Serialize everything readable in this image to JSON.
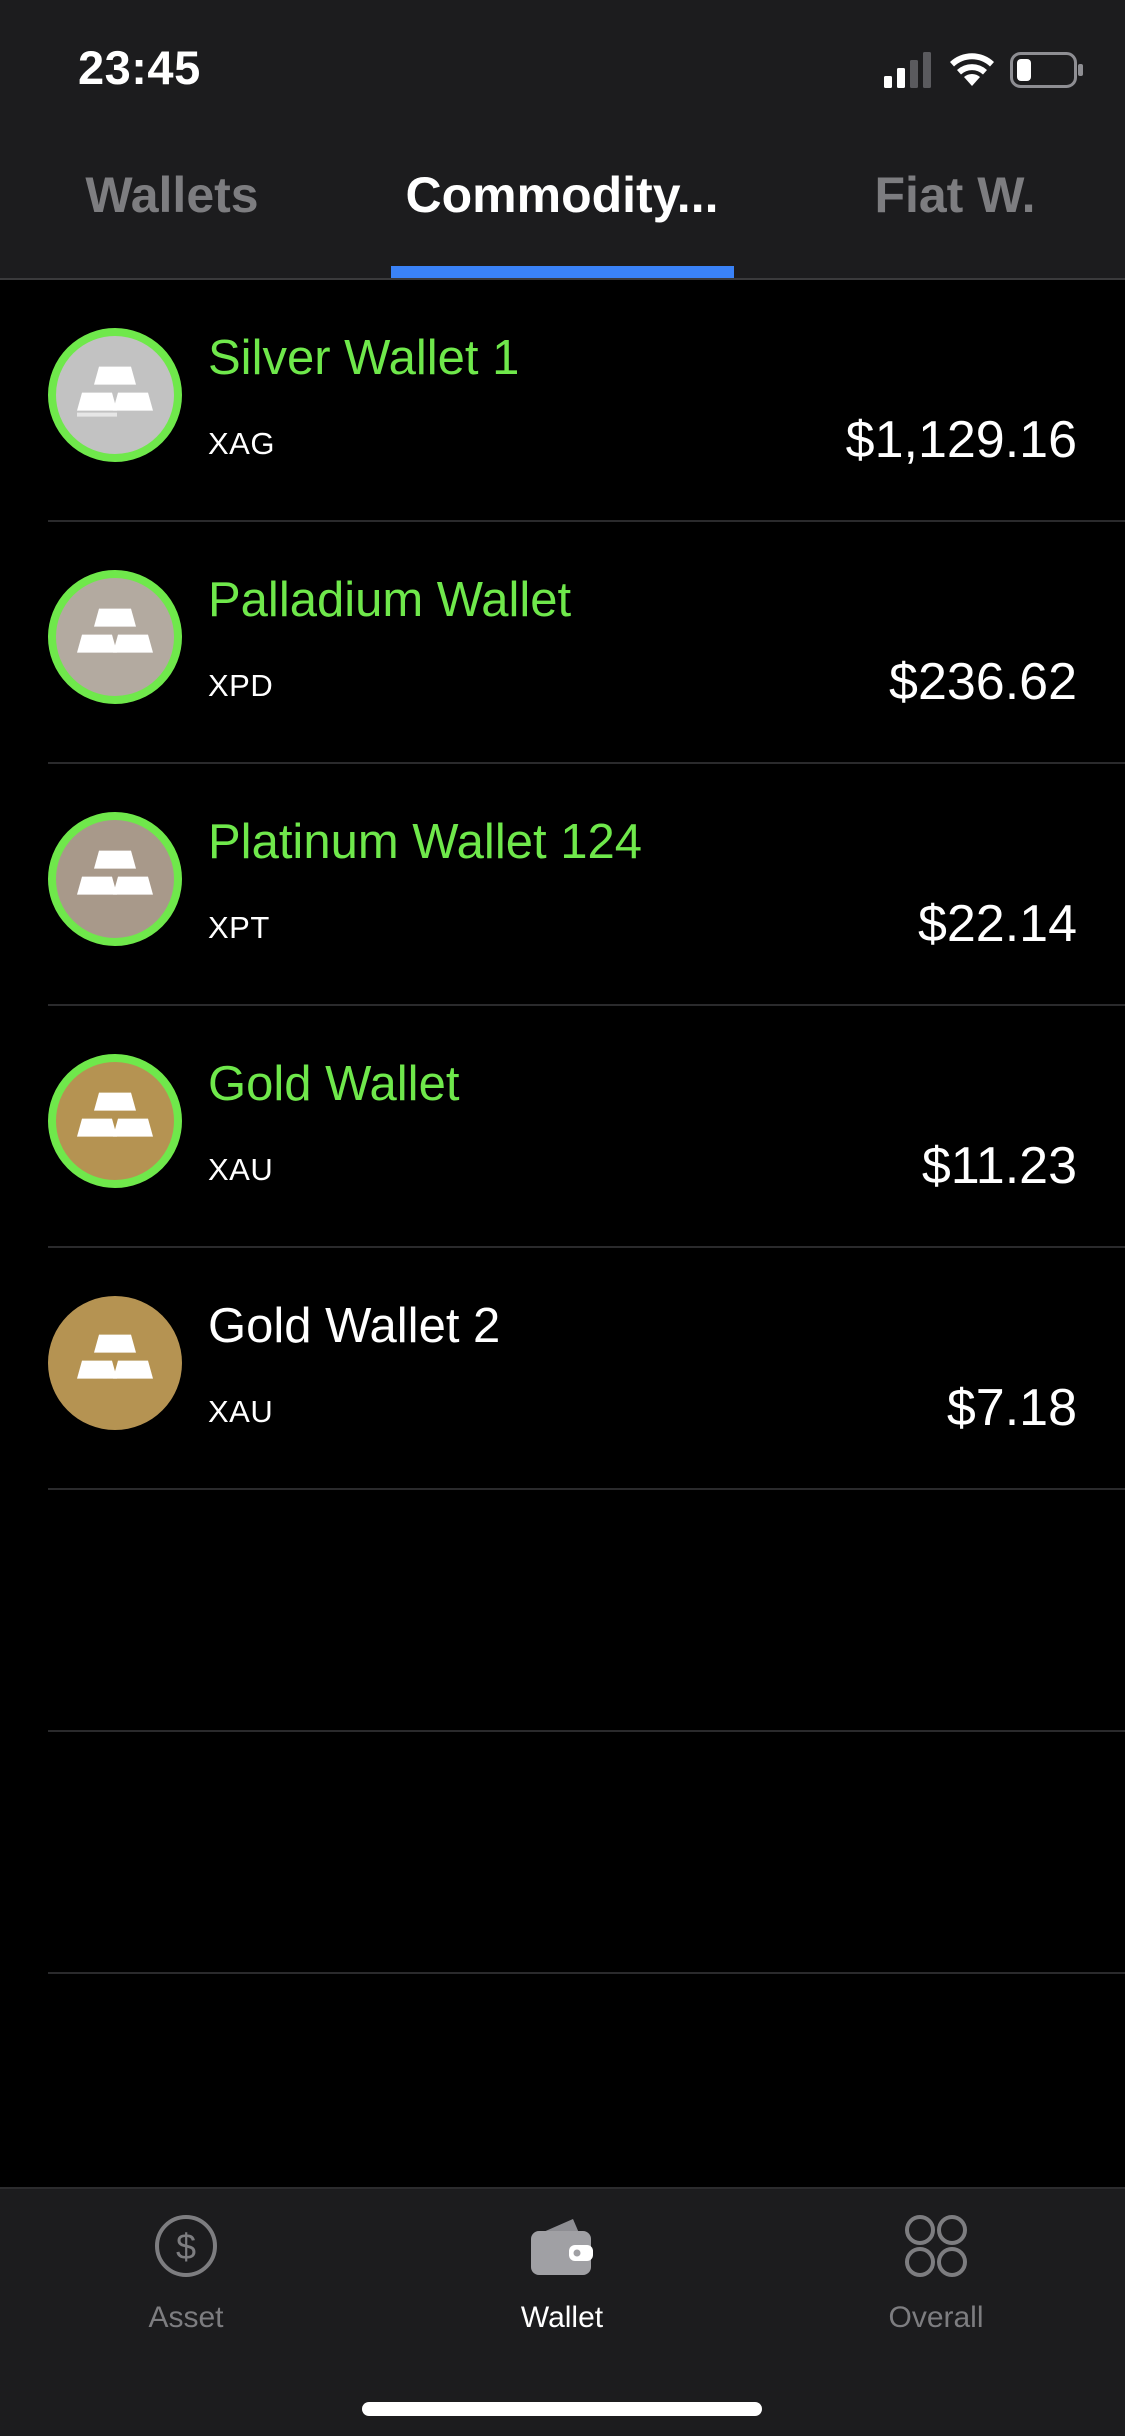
{
  "status_bar": {
    "time": "23:45",
    "icons": [
      "cellular-signal-icon",
      "wifi-icon",
      "battery-icon"
    ]
  },
  "top_tabs": [
    {
      "label": "Wallets",
      "active": false
    },
    {
      "label": "Commodity...",
      "active": true
    },
    {
      "label": "Fiat W.",
      "active": false
    }
  ],
  "wallets": [
    {
      "name": "Silver Wallet 1",
      "code": "XAG",
      "amount": "$1,129.16",
      "highlighted": true,
      "icon_bg": "#c2c2c2"
    },
    {
      "name": "Palladium Wallet",
      "code": "XPD",
      "amount": "$236.62",
      "highlighted": true,
      "icon_bg": "#b3aaa0"
    },
    {
      "name": "Platinum Wallet 124",
      "code": "XPT",
      "amount": "$22.14",
      "highlighted": true,
      "icon_bg": "#a8998a"
    },
    {
      "name": "Gold Wallet",
      "code": "XAU",
      "amount": "$11.23",
      "highlighted": true,
      "icon_bg": "#b59352"
    },
    {
      "name": "Gold Wallet 2",
      "code": "XAU",
      "amount": "$7.18",
      "highlighted": false,
      "icon_bg": "#b59352"
    }
  ],
  "bottom_tabs": [
    {
      "label": "Asset",
      "icon": "dollar-circle-icon",
      "active": false
    },
    {
      "label": "Wallet",
      "icon": "wallet-icon",
      "active": true
    },
    {
      "label": "Overall",
      "icon": "grid-circles-icon",
      "active": false
    }
  ],
  "colors": {
    "highlight_green": "#6fe84b",
    "tab_indicator": "#3a82f7",
    "bar_background": "#1c1c1e",
    "inactive_text": "#7d7d80"
  }
}
